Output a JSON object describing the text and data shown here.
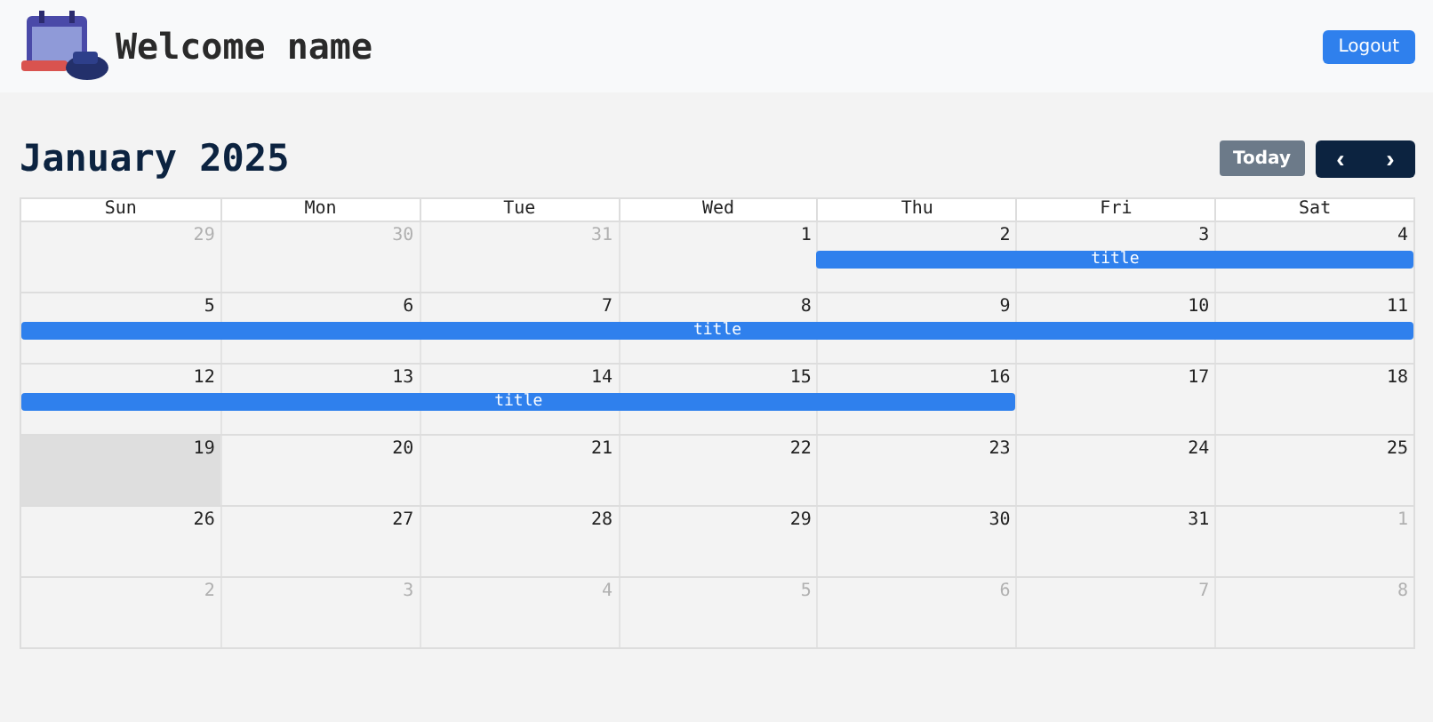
{
  "header": {
    "greeting": "Welcome name",
    "logout": "Logout"
  },
  "calendar": {
    "title": "January 2025",
    "today_button": "Today",
    "prev": "‹",
    "next": "›",
    "weekdays": [
      "Sun",
      "Mon",
      "Tue",
      "Wed",
      "Thu",
      "Fri",
      "Sat"
    ],
    "weeks": [
      [
        {
          "date": "29",
          "outside": true
        },
        {
          "date": "30",
          "outside": true
        },
        {
          "date": "31",
          "outside": true
        },
        {
          "date": "1"
        },
        {
          "date": "2",
          "event": "title",
          "in_event": true
        },
        {
          "date": "3",
          "in_event": true
        },
        {
          "date": "4",
          "in_event": true
        }
      ],
      [
        {
          "date": "5",
          "event": "title",
          "in_event": true
        },
        {
          "date": "6",
          "in_event": true
        },
        {
          "date": "7",
          "in_event": true
        },
        {
          "date": "8",
          "in_event": true
        },
        {
          "date": "9",
          "in_event": true
        },
        {
          "date": "10",
          "in_event": true
        },
        {
          "date": "11",
          "in_event": true
        }
      ],
      [
        {
          "date": "12",
          "event": "title",
          "in_event": true
        },
        {
          "date": "13",
          "in_event": true
        },
        {
          "date": "14",
          "in_event": true
        },
        {
          "date": "15",
          "in_event": true
        },
        {
          "date": "16",
          "in_event": true
        },
        {
          "date": "17"
        },
        {
          "date": "18"
        }
      ],
      [
        {
          "date": "19",
          "today": true
        },
        {
          "date": "20"
        },
        {
          "date": "21"
        },
        {
          "date": "22"
        },
        {
          "date": "23"
        },
        {
          "date": "24"
        },
        {
          "date": "25"
        }
      ],
      [
        {
          "date": "26"
        },
        {
          "date": "27"
        },
        {
          "date": "28"
        },
        {
          "date": "29"
        },
        {
          "date": "30"
        },
        {
          "date": "31"
        },
        {
          "date": "1",
          "outside": true
        }
      ],
      [
        {
          "date": "2",
          "outside": true
        },
        {
          "date": "3",
          "outside": true
        },
        {
          "date": "4",
          "outside": true
        },
        {
          "date": "5",
          "outside": true
        },
        {
          "date": "6",
          "outside": true
        },
        {
          "date": "7",
          "outside": true
        },
        {
          "date": "8",
          "outside": true
        }
      ]
    ]
  }
}
